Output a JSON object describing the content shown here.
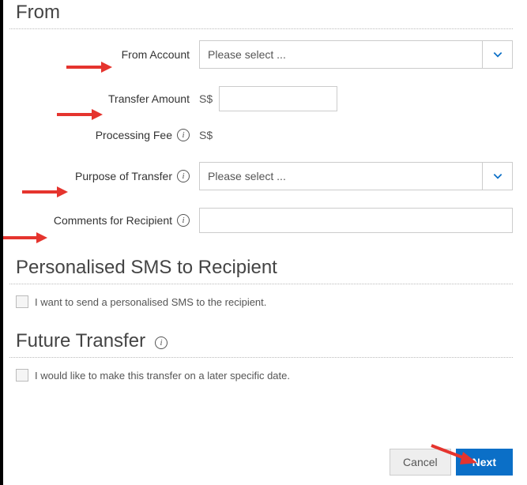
{
  "sections": {
    "from_title": "From",
    "sms_title": "Personalised SMS to Recipient",
    "future_title": "Future Transfer"
  },
  "fields": {
    "from_account": {
      "label": "From Account",
      "placeholder": "Please select ..."
    },
    "transfer_amount": {
      "label": "Transfer Amount",
      "currency": "S$",
      "value": ""
    },
    "processing_fee": {
      "label": "Processing Fee",
      "currency": "S$"
    },
    "purpose": {
      "label": "Purpose of Transfer",
      "placeholder": "Please select ..."
    },
    "comments": {
      "label": "Comments for Recipient",
      "value": ""
    }
  },
  "checkboxes": {
    "sms": "I want to send a personalised SMS to the recipient.",
    "future": "I would like to make this transfer on a later specific date."
  },
  "buttons": {
    "cancel": "Cancel",
    "next": "Next"
  }
}
